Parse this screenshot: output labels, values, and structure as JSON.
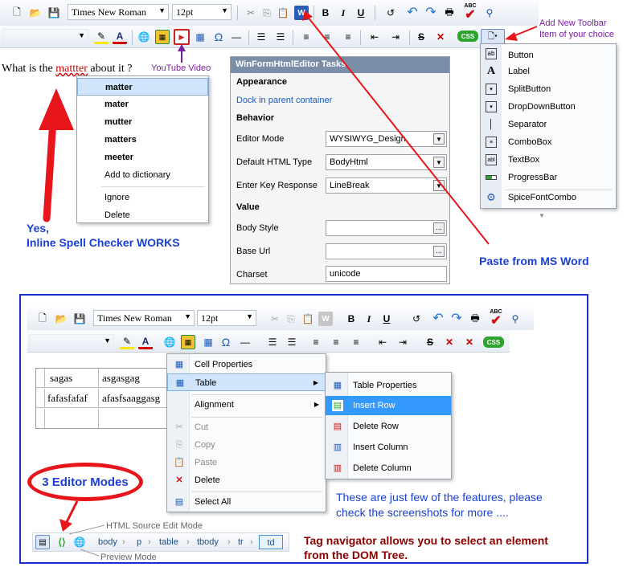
{
  "top_toolbar": {
    "font_name": "Times New Roman",
    "font_size": "12pt",
    "bold": "B",
    "italic": "I",
    "underline": "U",
    "css_badge": "CSS",
    "abc": "ABC",
    "omega": "Ω"
  },
  "editor_text": {
    "before": "What is the ",
    "misspelled": "mattter",
    "after": " about it ?"
  },
  "spell_menu": {
    "suggestions": [
      "matter",
      "mater",
      "mutter",
      "matters",
      "meeter"
    ],
    "add": "Add to dictionary",
    "ignore": "Ignore",
    "delete": "Delete"
  },
  "tasks_panel": {
    "title": "WinFormHtmlEditor Tasks",
    "appearance": "Appearance",
    "dock_link": "Dock in parent container",
    "behavior": "Behavior",
    "rows": [
      {
        "label": "Editor Mode",
        "value": "WYSIWYG_Design"
      },
      {
        "label": "Default HTML Type",
        "value": "BodyHtml"
      },
      {
        "label": "Enter Key Response",
        "value": "LineBreak"
      }
    ],
    "value_header": "Value",
    "value_rows": [
      {
        "label": "Body Style",
        "value": ""
      },
      {
        "label": "Base Url",
        "value": ""
      },
      {
        "label": "Charset",
        "value": "unicode"
      }
    ],
    "ellipsis": "..."
  },
  "toolbar_item_menu": {
    "items": [
      "Button",
      "Label",
      "SplitButton",
      "DropDownButton",
      "Separator",
      "ComboBox",
      "TextBox",
      "ProgressBar",
      "SpiceFontCombo"
    ]
  },
  "annotations": {
    "youtube": "YouTube Video",
    "add_toolbar": "Add New Toolbar\nItem of your choice",
    "spell_yes": "Yes,",
    "spell_works": "Inline Spell Checker WORKS",
    "paste_word": "Paste from MS Word",
    "features": "These are just few of the features, please\ncheck the screenshots for more ....",
    "tag_navigator": "Tag navigator allows you to select an element\nfrom the DOM Tree.",
    "html_source_mode": "HTML Source Edit Mode",
    "preview_mode": "Preview Mode",
    "three_modes": "3 Editor Modes"
  },
  "bottom_table": {
    "rows": [
      [
        "sagas",
        "asgasgag"
      ],
      [
        "fafasfafaf",
        "afasfsaaggasg"
      ],
      [
        "",
        ""
      ]
    ]
  },
  "context_menu": {
    "items": [
      "Cell Properties",
      "Table",
      "Alignment",
      "Cut",
      "Copy",
      "Paste",
      "Delete",
      "Select All"
    ]
  },
  "table_submenu": {
    "items": [
      "Table Properties",
      "Insert Row",
      "Delete Row",
      "Insert Column",
      "Delete Column"
    ]
  },
  "tag_nav": {
    "tags": [
      "body",
      "p",
      "table",
      "tbody",
      "tr",
      "td"
    ]
  },
  "colors": {
    "annotation_red": "#e8151b",
    "annotation_blue": "#1a3fd6",
    "annotation_purple": "#7a1ea1",
    "dark_red_text": "#8b0000",
    "frame_blue": "#1a2fcf",
    "selection": "#3399ff"
  }
}
